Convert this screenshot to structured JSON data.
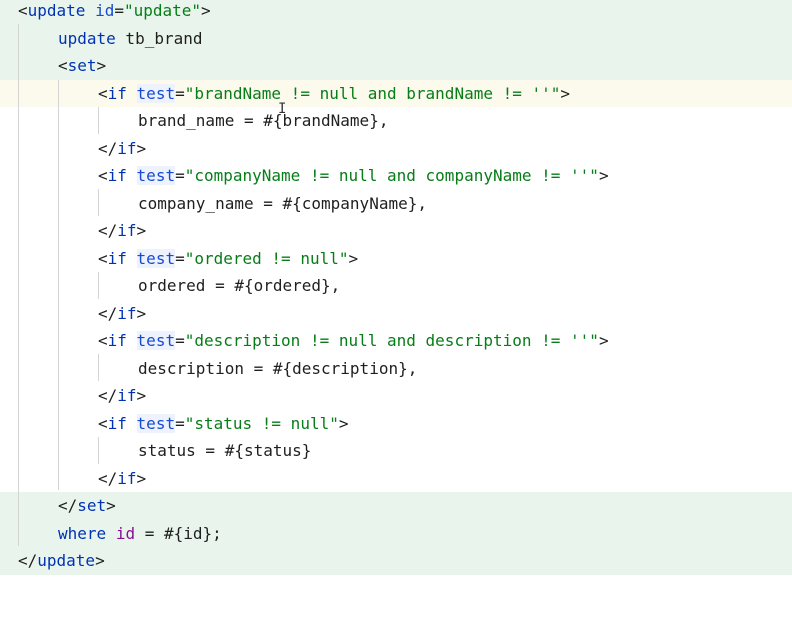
{
  "lines": [
    {
      "open": "<",
      "tag": "update",
      "sp": " ",
      "attr": "id",
      "eq": "=",
      "val": "\"update\"",
      "close": ">"
    },
    {
      "kw": "update",
      "rest": " tb_brand"
    },
    {
      "open": "<",
      "tag": "set",
      "close": ">"
    },
    {
      "open": "<",
      "tag": "if",
      "sp": " ",
      "attr": "test",
      "eq": "=",
      "val": "\"brandName != null and brandName != ''\"",
      "close": ">"
    },
    {
      "code": "brand_name = #{brandName},"
    },
    {
      "open": "</",
      "tag": "if",
      "close": ">"
    },
    {
      "open": "<",
      "tag": "if",
      "sp": " ",
      "attr": "test",
      "eq": "=",
      "val": "\"companyName != null and companyName != ''\"",
      "close": ">"
    },
    {
      "code": "company_name = #{companyName},"
    },
    {
      "open": "</",
      "tag": "if",
      "close": ">"
    },
    {
      "open": "<",
      "tag": "if",
      "sp": " ",
      "attr": "test",
      "eq": "=",
      "val": "\"ordered != null\"",
      "close": ">"
    },
    {
      "code": "ordered = #{ordered},"
    },
    {
      "open": "</",
      "tag": "if",
      "close": ">"
    },
    {
      "open": "<",
      "tag": "if",
      "sp": " ",
      "attr": "test",
      "eq": "=",
      "val": "\"description != null and description != ''\"",
      "close": ">"
    },
    {
      "code": "description = #{description},"
    },
    {
      "open": "</",
      "tag": "if",
      "close": ">"
    },
    {
      "open": "<",
      "tag": "if",
      "sp": " ",
      "attr": "test",
      "eq": "=",
      "val": "\"status != null\"",
      "close": ">"
    },
    {
      "code": "status = #{status}"
    },
    {
      "open": "</",
      "tag": "if",
      "close": ">"
    },
    {
      "open": "</",
      "tag": "set",
      "close": ">"
    },
    {
      "kw": "where",
      "sp": " ",
      "attr": "id",
      "rest": " = #{id};"
    },
    {
      "open": "</",
      "tag": "update",
      "close": ">"
    }
  ],
  "cursor_glyph": "I",
  "colors": {
    "keyword": "#0033b3",
    "string": "#067d17",
    "attribute": "#174ad4",
    "changed_line_bg": "#e9f5ec",
    "current_line_bg": "#fcfaed"
  }
}
